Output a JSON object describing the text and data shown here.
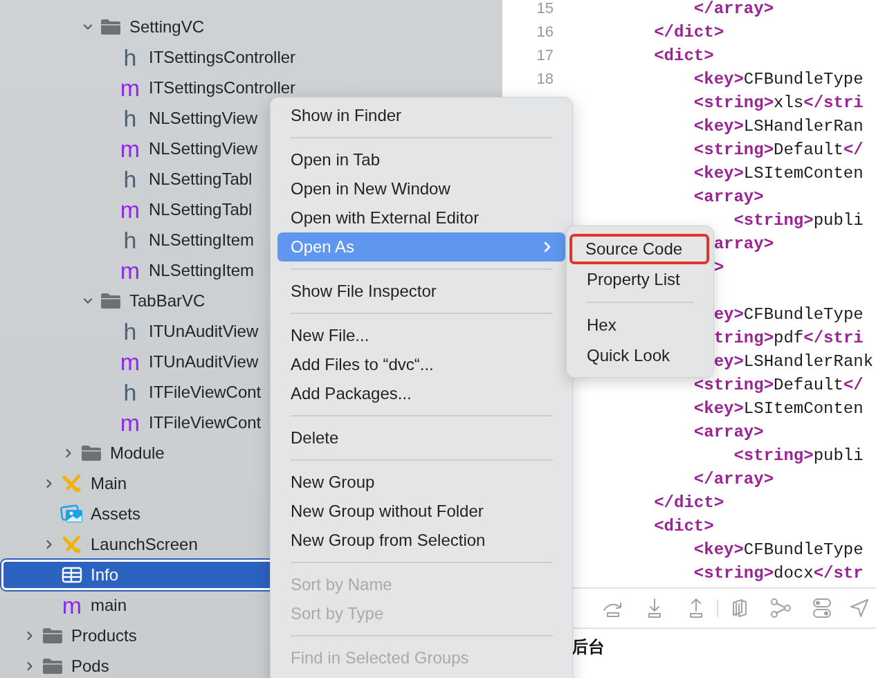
{
  "sidebar": {
    "tree": [
      {
        "children": [
          {
            "children": [
              {
                "children": [
                  {
                    "kind": "folder",
                    "label": "SettingVC",
                    "expanded": true,
                    "selected": false,
                    "children": [
                      {
                        "kind": "header",
                        "glyph": "h",
                        "label": "ITSettingsController",
                        "selected": false
                      },
                      {
                        "kind": "source",
                        "glyph": "m",
                        "label": "ITSettingsController",
                        "selected": false
                      },
                      {
                        "kind": "header",
                        "glyph": "h",
                        "label": "NLSettingView",
                        "selected": false
                      },
                      {
                        "kind": "source",
                        "glyph": "m",
                        "label": "NLSettingView",
                        "selected": false
                      },
                      {
                        "kind": "header",
                        "glyph": "h",
                        "label": "NLSettingTabl",
                        "selected": false
                      },
                      {
                        "kind": "source",
                        "glyph": "m",
                        "label": "NLSettingTabl",
                        "selected": false
                      },
                      {
                        "kind": "header",
                        "glyph": "h",
                        "label": "NLSettingItem",
                        "selected": false
                      },
                      {
                        "kind": "source",
                        "glyph": "m",
                        "label": "NLSettingItem",
                        "selected": false
                      }
                    ]
                  },
                  {
                    "kind": "folder",
                    "label": "TabBarVC",
                    "expanded": true,
                    "selected": false,
                    "children": [
                      {
                        "kind": "header",
                        "glyph": "h",
                        "label": "ITUnAuditView",
                        "selected": false
                      },
                      {
                        "kind": "source",
                        "glyph": "m",
                        "label": "ITUnAuditView",
                        "selected": false
                      },
                      {
                        "kind": "header",
                        "glyph": "h",
                        "label": "ITFileViewCont",
                        "selected": false
                      },
                      {
                        "kind": "source",
                        "glyph": "m",
                        "label": "ITFileViewCont",
                        "selected": false
                      }
                    ]
                  }
                ]
              },
              {
                "kind": "folder",
                "label": "Module",
                "expanded": false,
                "selected": false
              }
            ]
          },
          {
            "kind": "storyboard",
            "label": "Main",
            "expanded": false,
            "selected": false
          },
          {
            "kind": "assets",
            "label": "Assets",
            "selected": false
          },
          {
            "kind": "storyboard",
            "label": "LaunchScreen",
            "expanded": false,
            "selected": false
          },
          {
            "kind": "plist",
            "label": "Info",
            "selected": true
          },
          {
            "kind": "source",
            "glyph": "m",
            "label": "main",
            "selected": false
          }
        ]
      },
      {
        "kind": "folder",
        "label": "Products",
        "expanded": false,
        "selected": false
      },
      {
        "kind": "folder",
        "label": "Pods",
        "expanded": false,
        "selected": false
      }
    ]
  },
  "editor": {
    "lines": [
      {
        "number": "15",
        "segments": [
          {
            "kind": "tag",
            "text": "            </array>"
          }
        ]
      },
      {
        "number": "16",
        "segments": [
          {
            "kind": "tag",
            "text": "        </dict>"
          }
        ]
      },
      {
        "number": "17",
        "segments": [
          {
            "kind": "tag",
            "text": "        <dict>"
          }
        ]
      },
      {
        "number": "18",
        "segments": [
          {
            "kind": "tag",
            "text": "            <key>"
          },
          {
            "kind": "value",
            "text": "CFBundleType"
          }
        ]
      },
      {
        "segments": [
          {
            "kind": "tag",
            "text": "            <string>"
          },
          {
            "kind": "value",
            "text": "xls"
          },
          {
            "kind": "tag",
            "text": "</stri"
          }
        ]
      },
      {
        "segments": [
          {
            "kind": "tag",
            "text": "            <key>"
          },
          {
            "kind": "value",
            "text": "LSHandlerRan"
          }
        ]
      },
      {
        "segments": [
          {
            "kind": "tag",
            "text": "            <string>"
          },
          {
            "kind": "value",
            "text": "Default"
          },
          {
            "kind": "tag",
            "text": "</"
          }
        ]
      },
      {
        "segments": [
          {
            "kind": "tag",
            "text": "            <key>"
          },
          {
            "kind": "value",
            "text": "LSItemConten"
          }
        ]
      },
      {
        "segments": [
          {
            "kind": "tag",
            "text": "            <array>"
          }
        ]
      },
      {
        "segments": [
          {
            "kind": "tag",
            "text": "                <string>"
          },
          {
            "kind": "value",
            "text": "publi"
          }
        ]
      },
      {
        "segments": [
          {
            "kind": "tag",
            "text": "              array>"
          }
        ]
      },
      {
        "segments": [
          {
            "kind": "tag",
            "text": "              >"
          }
        ]
      },
      {
        "blank_before": true,
        "segments": [
          {
            "kind": "tag",
            "text": "              ey>"
          },
          {
            "kind": "value",
            "text": "CFBundleType"
          }
        ]
      },
      {
        "segments": [
          {
            "kind": "tag",
            "text": "              tring>"
          },
          {
            "kind": "value",
            "text": "pdf"
          },
          {
            "kind": "tag",
            "text": "</stri"
          }
        ]
      },
      {
        "segments": [
          {
            "kind": "tag",
            "text": "              ey>"
          },
          {
            "kind": "value",
            "text": "LSHandlerRank"
          }
        ]
      },
      {
        "segments": [
          {
            "kind": "tag",
            "text": "            <string>"
          },
          {
            "kind": "value",
            "text": "Default"
          },
          {
            "kind": "tag",
            "text": "</"
          }
        ]
      },
      {
        "segments": [
          {
            "kind": "tag",
            "text": "            <key>"
          },
          {
            "kind": "value",
            "text": "LSItemConten"
          }
        ]
      },
      {
        "segments": [
          {
            "kind": "tag",
            "text": "            <array>"
          }
        ]
      },
      {
        "segments": [
          {
            "kind": "tag",
            "text": "                <string>"
          },
          {
            "kind": "value",
            "text": "publi"
          }
        ]
      },
      {
        "segments": [
          {
            "kind": "tag",
            "text": "            </array>"
          }
        ]
      },
      {
        "segments": [
          {
            "kind": "tag",
            "text": "        </dict>"
          }
        ]
      },
      {
        "segments": [
          {
            "kind": "tag",
            "text": "        <dict>"
          }
        ]
      },
      {
        "segments": [
          {
            "kind": "tag",
            "text": "            <key>"
          },
          {
            "kind": "value",
            "text": "CFBundleType"
          }
        ]
      },
      {
        "segments": [
          {
            "kind": "tag",
            "text": "            <string>"
          },
          {
            "kind": "value",
            "text": "docx"
          },
          {
            "kind": "tag",
            "text": "</str"
          }
        ]
      }
    ],
    "console": {
      "text": "后台"
    }
  },
  "context_menu": {
    "groups": [
      [
        {
          "label": "Show in Finder",
          "selected": false,
          "disabled": false
        }
      ],
      [
        {
          "label": "Open in Tab",
          "selected": false,
          "disabled": false
        },
        {
          "label": "Open in New Window",
          "selected": false,
          "disabled": false
        },
        {
          "label": "Open with External Editor",
          "selected": false,
          "disabled": false
        },
        {
          "label": "Open As",
          "selected": true,
          "disabled": false,
          "submenu": {
            "groups": [
              [
                {
                  "label": "Source Code",
                  "selected": false,
                  "marked": true
                },
                {
                  "label": "Property List",
                  "selected": false,
                  "marked": false
                }
              ],
              [
                {
                  "label": "Hex",
                  "selected": false,
                  "marked": false
                },
                {
                  "label": "Quick Look",
                  "selected": false,
                  "marked": false
                }
              ]
            ]
          }
        }
      ],
      [
        {
          "label": "Show File Inspector",
          "selected": false,
          "disabled": false
        }
      ],
      [
        {
          "label": "New File...",
          "selected": false,
          "disabled": false
        },
        {
          "label": "Add Files to “dvc“...",
          "selected": false,
          "disabled": false
        },
        {
          "label": "Add Packages...",
          "selected": false,
          "disabled": false
        }
      ],
      [
        {
          "label": "Delete",
          "selected": false,
          "disabled": false
        }
      ],
      [
        {
          "label": "New Group",
          "selected": false,
          "disabled": false
        },
        {
          "label": "New Group without Folder",
          "selected": false,
          "disabled": false
        },
        {
          "label": "New Group from Selection",
          "selected": false,
          "disabled": false
        }
      ],
      [
        {
          "label": "Sort by Name",
          "selected": false,
          "disabled": true
        },
        {
          "label": "Sort by Type",
          "selected": false,
          "disabled": true
        }
      ],
      [
        {
          "label": "Find in Selected Groups",
          "selected": false,
          "disabled": true
        }
      ]
    ]
  }
}
